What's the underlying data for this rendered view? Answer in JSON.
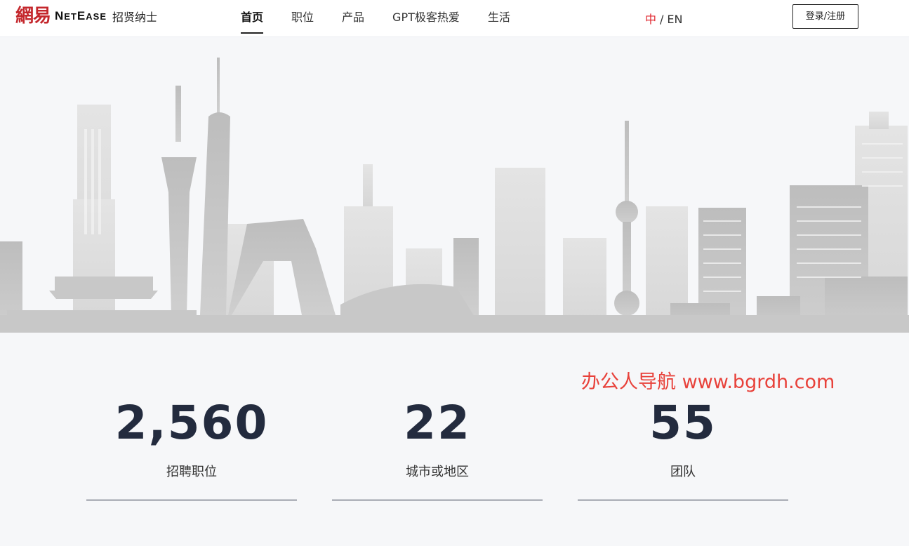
{
  "header": {
    "logo_cn": "網易",
    "logo_en_a": "N",
    "logo_en_b": "ET",
    "logo_en_c": "E",
    "logo_en_d": "ASE",
    "logo_sub": "招贤纳士",
    "nav": [
      {
        "label": "首页",
        "active": true
      },
      {
        "label": "职位",
        "active": false
      },
      {
        "label": "产品",
        "active": false
      },
      {
        "label": "GPT极客热爱",
        "active": false
      },
      {
        "label": "生活",
        "active": false
      }
    ],
    "lang_zh": "中",
    "lang_sep": "/",
    "lang_en": "EN",
    "login_label": "登录/注册"
  },
  "watermark": "办公人导航 www.bgrdh.com",
  "stats": [
    {
      "value": "2,560",
      "label": "招聘职位"
    },
    {
      "value": "22",
      "label": "城市或地区"
    },
    {
      "value": "55",
      "label": "团队"
    }
  ],
  "colors": {
    "accent": "#e0262e",
    "stat_text": "#232b3e",
    "skyline_dark": "#b9b9b9",
    "skyline_light": "#dedede"
  }
}
